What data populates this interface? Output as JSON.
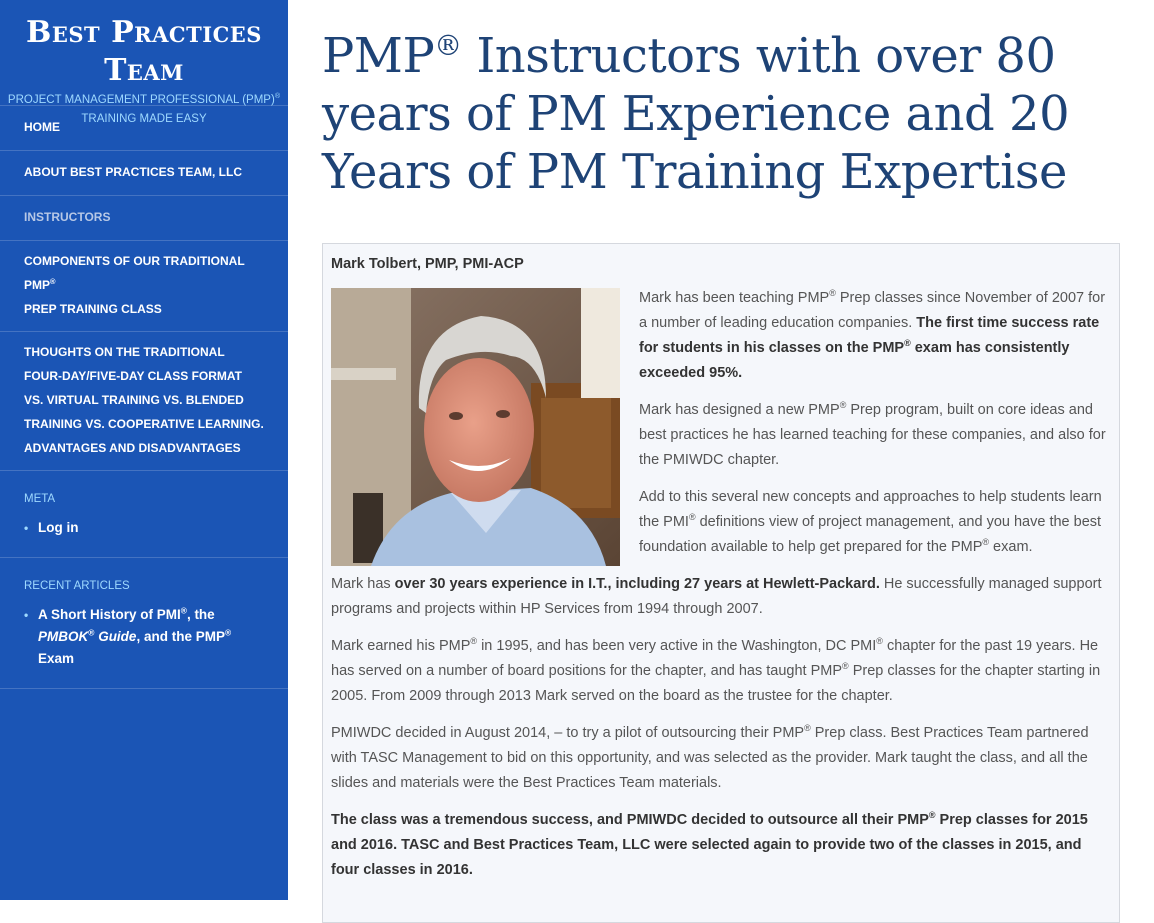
{
  "brand": {
    "title": "Best Practices Team",
    "subtitle_line1": "PROJECT MANAGEMENT PROFESSIONAL (PMP)",
    "subtitle_reg": "®",
    "subtitle_line2": "TRAINING MADE EASY"
  },
  "nav": {
    "home": "HOME",
    "about": "ABOUT BEST PRACTICES TEAM, LLC",
    "instructors": "INSTRUCTORS",
    "components_a": "COMPONENTS OF OUR TRADITIONAL PMP",
    "components_reg": "®",
    "components_b": "PREP TRAINING CLASS",
    "thoughts": "THOUGHTS ON THE TRADITIONAL FOUR-DAY/FIVE-DAY CLASS FORMAT VS. VIRTUAL TRAINING VS. BLENDED TRAINING VS. COOPERATIVE LEARNING. ADVANTAGES AND DISADVANTAGES"
  },
  "meta": {
    "title": "META",
    "login": "Log in"
  },
  "recent": {
    "title": "RECENT ARTICLES",
    "article_a": "A Short History of PMI",
    "reg": "®",
    "article_b": ", the",
    "article_c": "PMBOK",
    "article_d": "Guide",
    "article_e": ", and the PMP",
    "article_f": "  Exam"
  },
  "page": {
    "title_a": "PMP",
    "title_reg": "®",
    "title_b": " Instructors with over 80 years of PM Experience and 20 Years of PM Training Expertise"
  },
  "instructor": {
    "name": "Mark Tolbert, PMP, PMI-ACP",
    "photo_alt": "Portrait of Mark Tolbert",
    "reg": "®",
    "p1_a": "Mark has been teaching PMP",
    "p1_b": " Prep classes since November of 2007 for a number of leading education companies. ",
    "p1_bold_a": "The first time success rate for students in his classes on the PMP",
    "p1_bold_b": " exam has consistently exceeded 95%.",
    "p2_a": "Mark has designed a new PMP",
    "p2_b": " Prep program, built on core ideas and best practices he has learned teaching for these companies, and also for the PMIWDC chapter.",
    "p3_a": "Add to this several new concepts and approaches to help students learn the PMI",
    "p3_b": " definitions view of project management, and you have the best foundation available to help get prepared for the PMP",
    "p3_c": " exam.",
    "p4_a": "Mark has ",
    "p4_bold": "over 30 years experience in I.T., including 27 years at Hewlett-Packard.",
    "p4_b": " He successfully managed support programs and projects within HP Services from 1994 through 2007.",
    "p5_a": "Mark earned his PMP",
    "p5_b": " in 1995, and has been very active in the Washington, DC PMI",
    "p5_c": " chapter for the past 19 years. He has served on a number of board positions for the chapter, and has taught PMP",
    "p5_d": " Prep classes for the chapter starting in 2005. From 2009 through 2013 Mark served on the board as the trustee for the chapter.",
    "p6_a": "PMIWDC decided in August 2014, – to try a pilot of outsourcing their PMP",
    "p6_b": " Prep class. Best Practices Team partnered with TASC Management to bid on this opportunity, and was selected as the provider. Mark taught the class, and all the slides and materials were the Best Practices Team materials.",
    "p7_a": "The class was a tremendous success, and PMIWDC decided to outsource all their PMP",
    "p7_b": " Prep classes for 2015 and 2016. TASC and Best Practices Team, LLC were selected again to provide two of the classes in 2015, and four classes in 2016."
  }
}
